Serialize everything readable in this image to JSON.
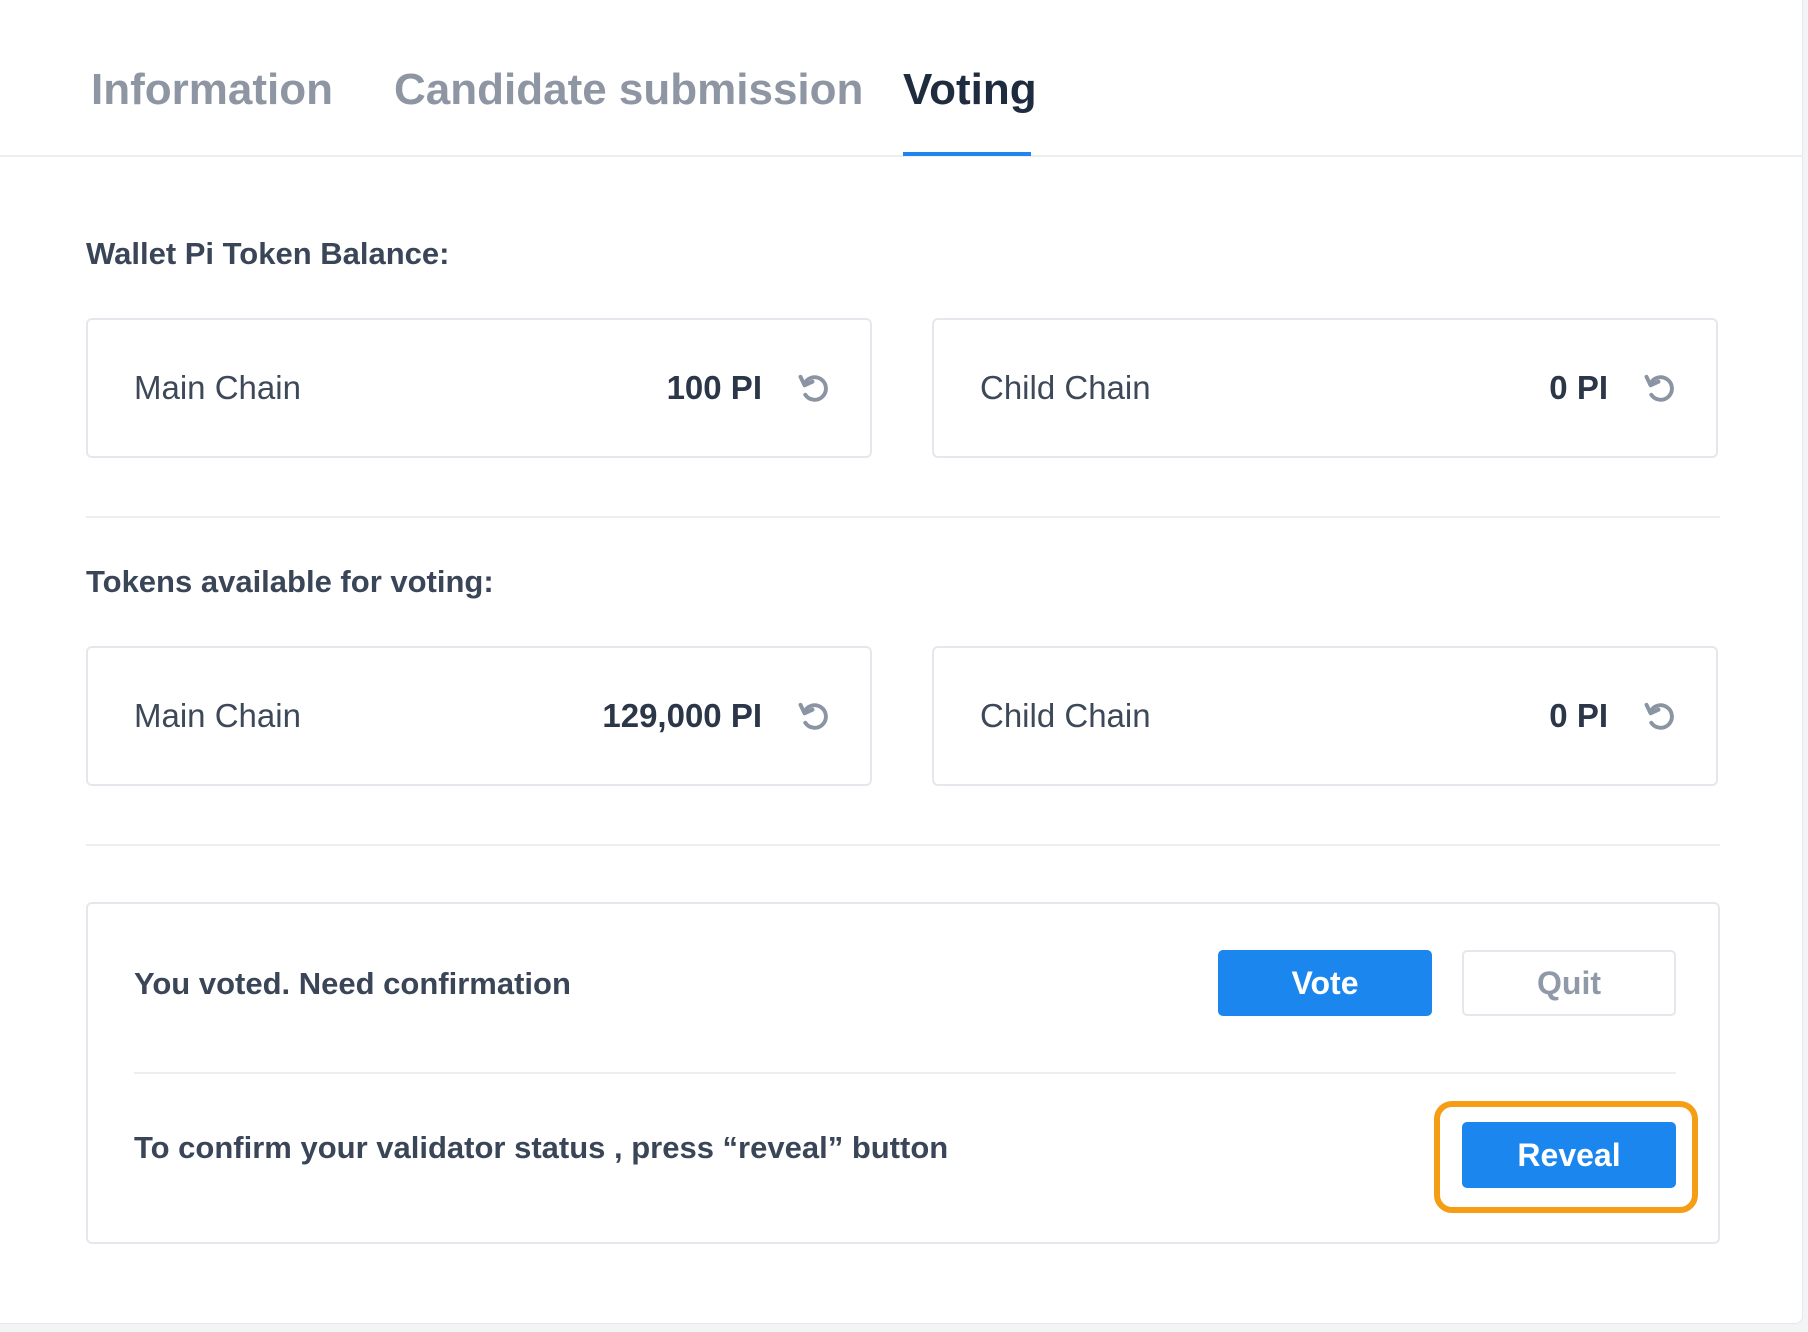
{
  "tabs": [
    {
      "label": "Information",
      "active": false
    },
    {
      "label": "Candidate submission",
      "active": false
    },
    {
      "label": "Voting",
      "active": true
    }
  ],
  "wallet_balance": {
    "title": "Wallet Pi Token Balance:",
    "main_chain": {
      "label": "Main Chain",
      "value": "100 PI"
    },
    "child_chain": {
      "label": "Child Chain",
      "value": "0 PI"
    }
  },
  "tokens_for_voting": {
    "title": "Tokens available for voting:",
    "main_chain": {
      "label": "Main Chain",
      "value": "129,000 PI"
    },
    "child_chain": {
      "label": "Child Chain",
      "value": "0 PI"
    }
  },
  "vote_status": {
    "message": "You voted. Need confirmation",
    "vote_label": "Vote",
    "quit_label": "Quit"
  },
  "confirm": {
    "message": "To confirm your validator status , press “reveal” button",
    "reveal_label": "Reveal"
  },
  "colors": {
    "accent": "#1a86ee",
    "highlight": "#f59d14",
    "active_tab": "#1f2b3e",
    "inactive_tab": "#8e96a4"
  },
  "icons": {
    "refresh": "refresh-icon"
  }
}
